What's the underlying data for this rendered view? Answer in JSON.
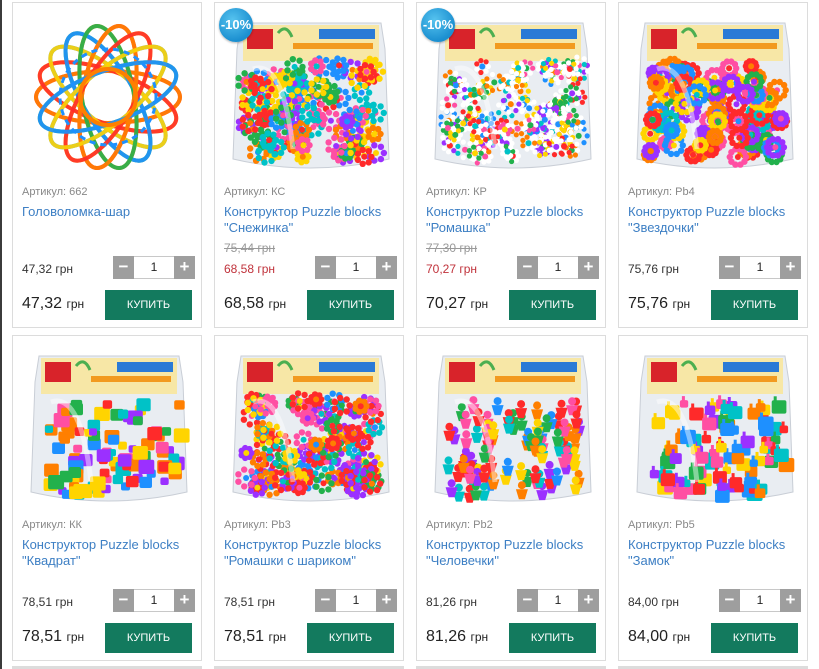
{
  "currency": "грн",
  "buy_label": "КУПИТЬ",
  "products": [
    {
      "sku": "Артикул: 662",
      "title": "Головоломка-шар",
      "old_price": "",
      "unit_price": "47,32 грн",
      "qty": "1",
      "price": "47,32",
      "discount": "",
      "pack": "ball"
    },
    {
      "sku": "Артикул: КС",
      "title": "Конструктор Puzzle blocks \"Снежинка\"",
      "old_price": "75,44 грн",
      "unit_price": "68,58 грн",
      "qty": "1",
      "price": "68,58",
      "discount": "-10%",
      "pack": "flowers"
    },
    {
      "sku": "Артикул: КР",
      "title": "Конструктор Puzzle blocks \"Ромашка\"",
      "old_price": "77,30 грн",
      "unit_price": "70,27 грн",
      "qty": "1",
      "price": "70,27",
      "discount": "-10%",
      "pack": "daisy"
    },
    {
      "sku": "Артикул: Pb4",
      "title": "Конструктор Puzzle blocks \"Звездочки\"",
      "old_price": "",
      "unit_price": "75,76 грн",
      "qty": "1",
      "price": "75,76",
      "discount": "",
      "pack": "stars"
    },
    {
      "sku": "Артикул: КК",
      "title": "Конструктор Puzzle blocks \"Квадрат\"",
      "old_price": "",
      "unit_price": "78,51 грн",
      "qty": "1",
      "price": "78,51",
      "discount": "",
      "pack": "squares"
    },
    {
      "sku": "Артикул: Pb3",
      "title": "Конструктор Puzzle blocks \"Ромашки с шариком\"",
      "old_price": "",
      "unit_price": "78,51 грн",
      "qty": "1",
      "price": "78,51",
      "discount": "",
      "pack": "flowers"
    },
    {
      "sku": "Артикул: Pb2",
      "title": "Конструктор Puzzle blocks \"Человечки\"",
      "old_price": "",
      "unit_price": "81,26 грн",
      "qty": "1",
      "price": "81,26",
      "discount": "",
      "pack": "people"
    },
    {
      "sku": "Артикул: Pb5",
      "title": "Конструктор Puzzle blocks \"Замок\"",
      "old_price": "",
      "unit_price": "84,00 грн",
      "qty": "1",
      "price": "84,00",
      "discount": "",
      "pack": "castle"
    }
  ],
  "colors": {
    "link": "#3d7fc4",
    "sale_price": "#c0323b",
    "buy_button": "#137a5e",
    "qty_button": "#9e9e9e",
    "badge": "#1b8fd0"
  }
}
